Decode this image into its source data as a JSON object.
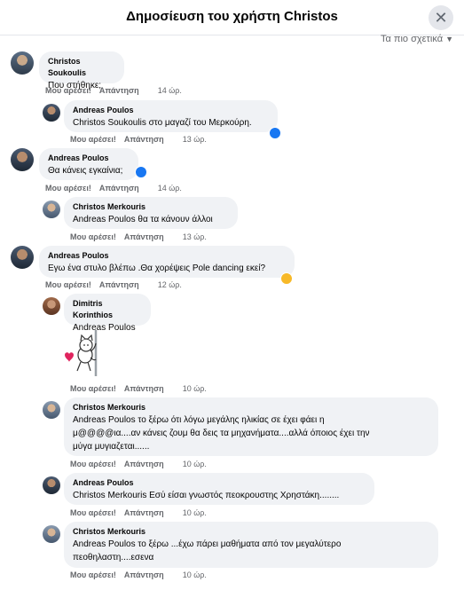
{
  "header": {
    "title": "Δημοσίευση του χρήστη Christos",
    "close_icon": "close-icon"
  },
  "sort": {
    "label": "Τα πιο σχετικά"
  },
  "actions": {
    "like": "Μου αρέσει!",
    "reply": "Απάντηση"
  },
  "comments": [
    {
      "author": "Christos Soukoulis",
      "text": "Που στήθηκε;",
      "time": "14 ώρ."
    },
    {
      "author": "Andreas Poulos",
      "mention": "Christos Soukoulis",
      "text": "στο μαγαζί του Μερκούρη.",
      "time": "13 ώρ."
    },
    {
      "author": "Andreas Poulos",
      "text": "Θα κάνεις εγκαίνια;",
      "time": "14 ώρ."
    },
    {
      "author": "Christos Merkouris",
      "mention": "Andreas Poulos",
      "text": "θα τα κάνουν άλλοι",
      "time": "13 ώρ."
    },
    {
      "author": "Andreas Poulos",
      "text": "Εγω ένα στυλο βλέπω .Θα χορέψεις Pole dancing εκεί?",
      "time": "12 ώρ."
    },
    {
      "author": "Dimitris Korinthios",
      "mention": "Andreas Poulos",
      "time": "10 ώρ."
    },
    {
      "author": "Christos Merkouris",
      "mention": "Andreas Poulos",
      "text_line1": "το ξέρω ότι λόγω μεγάλης ηλικίας σε έχει φάει η",
      "text_line2": "μ@@@@ια....αν κάνεις ζουμ θα δεις τα μηχανήματα....αλλά όποιος έχει την",
      "text_line3": "μύγα μυγιαζεται......",
      "time": "10 ώρ."
    },
    {
      "author": "Andreas Poulos",
      "mention": "Christos Merkouris",
      "text": "Εσύ είσαι γνωστός πεοκρουστης Χρηστάκη........",
      "time": "10 ώρ."
    },
    {
      "author": "Christos Merkouris",
      "mention": "Andreas Poulos",
      "text_line1": "το ξέρω ...έχω πάρει μαθήματα από τον μεγαλύτερο",
      "text_line2": "πεοθηλαστη....εσενα",
      "time": "10 ώρ."
    }
  ]
}
